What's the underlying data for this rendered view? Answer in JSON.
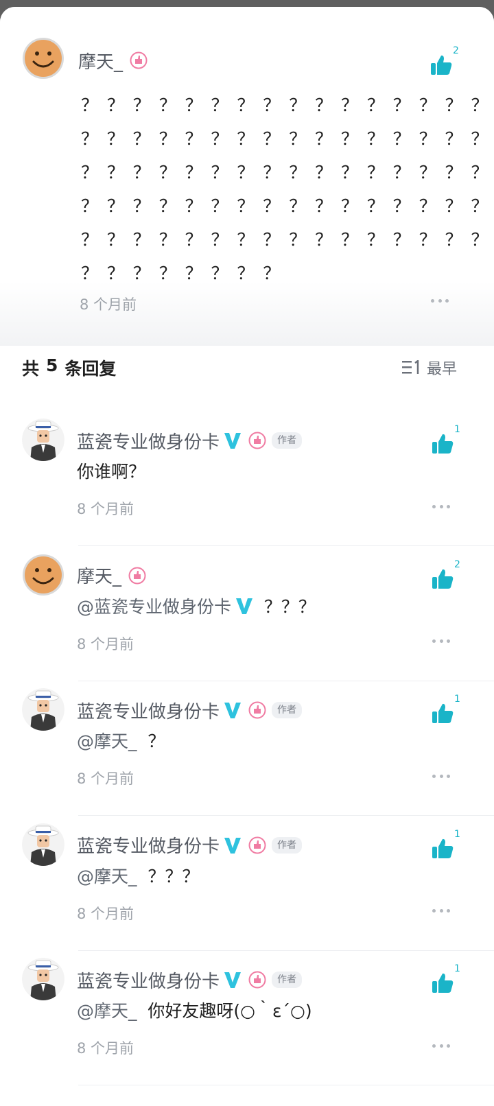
{
  "main_comment": {
    "user": "摩天_",
    "likes": "2",
    "text_rows": [
      "？？？？？？？？？？？？？？？？？？？？",
      "？？？？？？？？？？？？？？？？？？？？",
      "？？？？？？？？？？？？？？？？？？？？",
      "？？？？？？？？？？？？？？？？？？？？",
      "？？？？？？？？？？？？？？？？？？？？",
      "？？？？？？？？"
    ],
    "time": "8 个月前"
  },
  "replies_header": {
    "prefix": "共",
    "count": "5",
    "suffix": "条回复",
    "sort_label": "最早"
  },
  "replies": [
    {
      "user": "蓝瓷专业做身份卡",
      "verified": true,
      "author_tag": "作者",
      "likes": "1",
      "mention": "",
      "text": "你谁啊？",
      "time": "8 个月前",
      "avatar": "hat-man"
    },
    {
      "user": "摩天_",
      "verified": false,
      "author_tag": "",
      "likes": "2",
      "mention": "@蓝瓷专业做身份卡",
      "text": "？？？",
      "time": "8 个月前",
      "avatar": "smiley"
    },
    {
      "user": "蓝瓷专业做身份卡",
      "verified": true,
      "author_tag": "作者",
      "likes": "1",
      "mention": "@摩天_",
      "text": "？",
      "time": "8 个月前",
      "avatar": "hat-man"
    },
    {
      "user": "蓝瓷专业做身份卡",
      "verified": true,
      "author_tag": "作者",
      "likes": "1",
      "mention": "@摩天_",
      "text": "？？？",
      "time": "8 个月前",
      "avatar": "hat-man"
    },
    {
      "user": "蓝瓷专业做身份卡",
      "verified": true,
      "author_tag": "作者",
      "likes": "1",
      "mention": "@摩天_",
      "text": "你好友趣呀(○｀ε´○)",
      "time": "8 个月前",
      "avatar": "hat-man"
    }
  ],
  "colors": {
    "accent": "#1ab4c8",
    "level_badge": "#f07ca3",
    "verified": "#2ec2de"
  }
}
